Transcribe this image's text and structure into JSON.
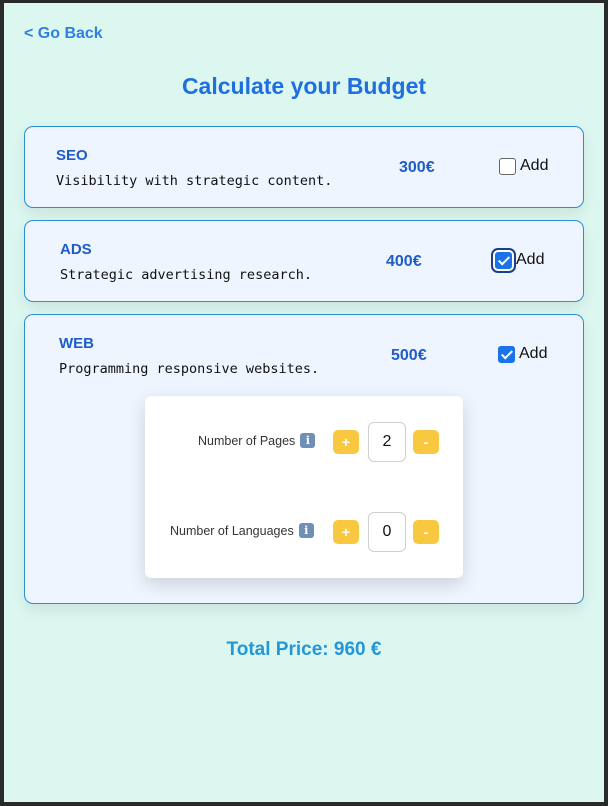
{
  "nav": {
    "back_label": "< Go Back"
  },
  "page": {
    "title": "Calculate your Budget"
  },
  "services": [
    {
      "name": "SEO",
      "description": "Visibility with strategic content.",
      "price": "300€",
      "add_label": "Add",
      "checked": false
    },
    {
      "name": "ADS",
      "description": "Strategic advertising research.",
      "price": "400€",
      "add_label": "Add",
      "checked": true
    },
    {
      "name": "WEB",
      "description": "Programming responsive websites.",
      "price": "500€",
      "add_label": "Add",
      "checked": true
    }
  ],
  "web_options": {
    "pages": {
      "label": "Number of Pages",
      "value": "2",
      "plus": "+",
      "minus": "-",
      "info_icon": "information-icon"
    },
    "languages": {
      "label": "Number of Languages",
      "value": "0",
      "plus": "+",
      "minus": "-",
      "info_icon": "information-icon"
    }
  },
  "total": {
    "label": "Total Price: 960 €"
  },
  "colors": {
    "background": "#dcf7f0",
    "accent": "#1f6fe0",
    "card_border": "#2a8fd0",
    "stepper": "#f8c940",
    "total": "#2596d6"
  }
}
